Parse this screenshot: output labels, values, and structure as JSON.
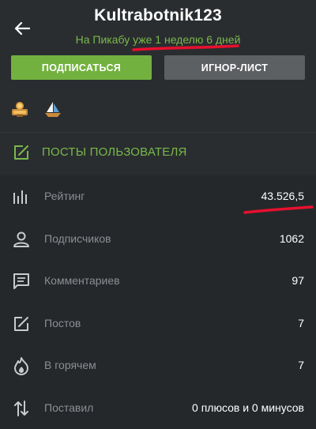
{
  "profile": {
    "username": "Kultrabotnik123",
    "since_text": "На Пикабу уже 1 неделю 6 дней"
  },
  "actions": {
    "subscribe_label": "ПОДПИСАТЬСЯ",
    "ignore_label": "ИГНОР-ЛИСТ"
  },
  "awards": [
    {
      "icon": "medal-100-award-icon"
    },
    {
      "icon": "sailboat-award-icon"
    }
  ],
  "posts_link": {
    "label": "ПОСТЫ ПОЛЬЗОВАТЕЛЯ",
    "icon": "edit-icon"
  },
  "stats": [
    {
      "icon": "bar-chart-icon",
      "label": "Рейтинг",
      "value": "43.526,5"
    },
    {
      "icon": "person-icon",
      "label": "Подписчиков",
      "value": "1062"
    },
    {
      "icon": "comment-icon",
      "label": "Комментариев",
      "value": "97"
    },
    {
      "icon": "edit-icon",
      "label": "Постов",
      "value": "7"
    },
    {
      "icon": "flame-icon",
      "label": "В горячем",
      "value": "7"
    },
    {
      "icon": "swap-vertical-icon",
      "label": "Поставил",
      "value": "0 плюсов и 0 минусов"
    }
  ],
  "colors": {
    "background": "#25282b",
    "header": "#2a2d30",
    "accent_green": "#72b13f",
    "link_green": "#79b94a",
    "annotation_red": "#e8102e",
    "button_gray": "#5d6063"
  }
}
